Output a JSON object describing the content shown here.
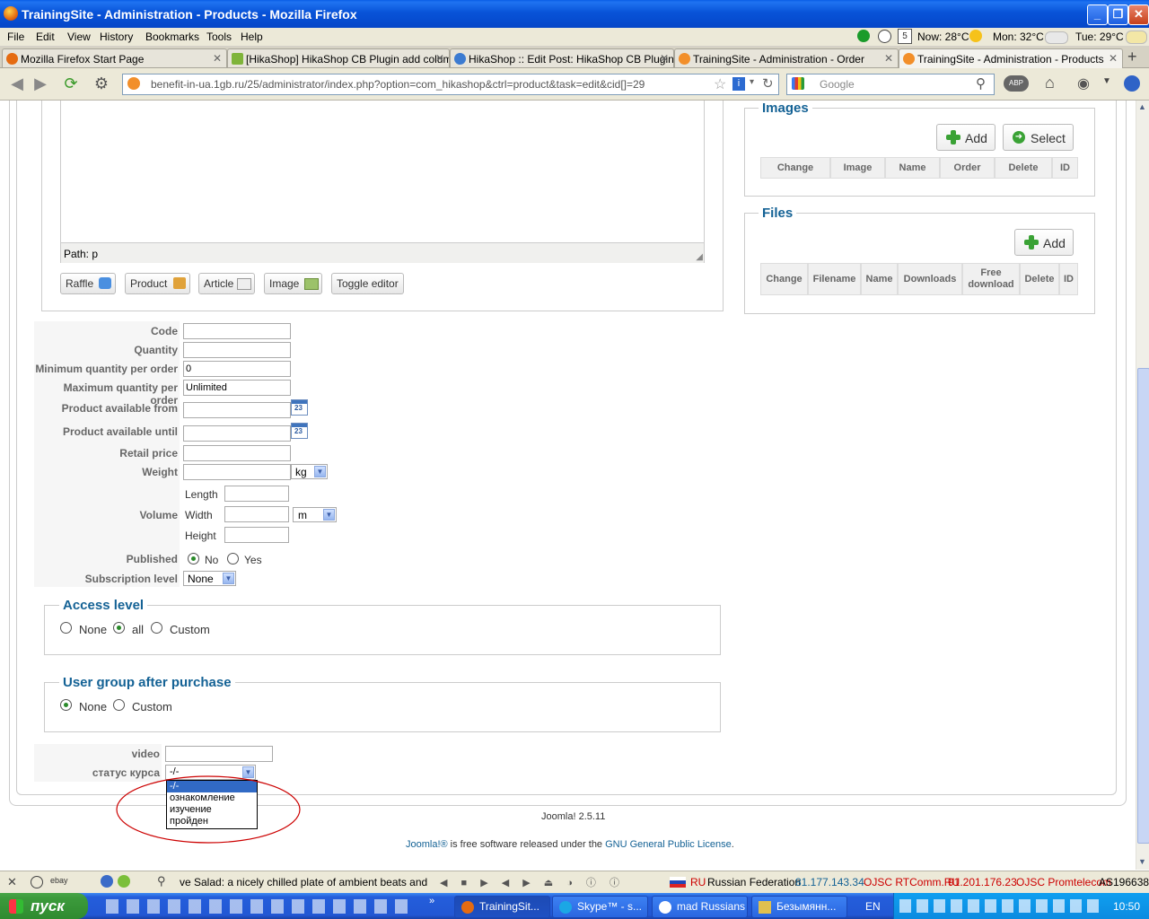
{
  "window": {
    "title": "TrainingSite - Administration - Products - Mozilla Firefox"
  },
  "menubar": {
    "items": [
      "File",
      "Edit",
      "View",
      "History",
      "Bookmarks",
      "Tools",
      "Help"
    ],
    "weather": {
      "calendar_day": "5",
      "now": "Now: 28°C",
      "mon": "Mon: 32°C",
      "tue": "Tue: 29°C"
    }
  },
  "tabs": [
    {
      "label": "Mozilla Firefox Start Page",
      "active": false
    },
    {
      "label": "[HikaShop] HikaShop CB Plugin add colum...",
      "active": false
    },
    {
      "label": "HikaShop :: Edit Post: HikaShop CB Plugin...",
      "active": false
    },
    {
      "label": "TrainingSite - Administration - Order",
      "active": false
    },
    {
      "label": "TrainingSite - Administration - Products",
      "active": true
    }
  ],
  "navbar": {
    "url": "benefit-in-ua.1gb.ru/25/administrator/index.php?option=com_hikashop&ctrl=product&task=edit&cid[]=29",
    "search_placeholder": "Google"
  },
  "editor": {
    "path": "Path: p",
    "buttons": [
      "Raffle",
      "Product",
      "Article",
      "Image",
      "Toggle editor"
    ]
  },
  "images_panel": {
    "title": "Images",
    "add": "Add",
    "select": "Select",
    "columns": [
      "Change",
      "Image",
      "Name",
      "Order",
      "Delete",
      "ID"
    ]
  },
  "files_panel": {
    "title": "Files",
    "add": "Add",
    "columns": [
      "Change",
      "Filename",
      "Name",
      "Downloads",
      "Free download",
      "Delete",
      "ID"
    ]
  },
  "form": {
    "code": {
      "label": "Code",
      "value": ""
    },
    "quantity": {
      "label": "Quantity",
      "value": ""
    },
    "min_qty": {
      "label": "Minimum quantity per order",
      "value": "0"
    },
    "max_qty": {
      "label": "Maximum quantity per order",
      "value": "Unlimited"
    },
    "available_from": {
      "label": "Product available from",
      "value": ""
    },
    "available_until": {
      "label": "Product available until",
      "value": ""
    },
    "calendar_icon_text": "23",
    "retail_price": {
      "label": "Retail price",
      "value": ""
    },
    "weight": {
      "label": "Weight",
      "value": "",
      "unit": "kg"
    },
    "volume": {
      "label": "Volume",
      "length": "Length",
      "width": "Width",
      "height": "Height",
      "unit": "m"
    },
    "published": {
      "label": "Published",
      "options": [
        "No",
        "Yes"
      ],
      "selected": "No"
    },
    "subscription": {
      "label": "Subscription level",
      "value": "None"
    }
  },
  "access_level": {
    "title": "Access level",
    "options": [
      "None",
      "all",
      "Custom"
    ],
    "selected": "all"
  },
  "user_group": {
    "title": "User group after purchase",
    "options": [
      "None",
      "Custom"
    ],
    "selected": "None"
  },
  "custom_fields": {
    "video": {
      "label": "video",
      "value": ""
    },
    "course_status": {
      "label": "статус курса",
      "value": "-/-",
      "options": [
        "-/-",
        "ознакомление",
        "изучение",
        "пройден"
      ],
      "highlighted": "-/-"
    }
  },
  "footer": {
    "version": "Joomla! 2.5.11",
    "license_prefix": "Joomla!®",
    "license_middle": " is free software released under the ",
    "license_link": "GNU General Public License",
    "license_suffix": "."
  },
  "statusbar": {
    "ebay": "ebay",
    "ticker": "ve Salad: a nicely chilled plate of ambient beats and",
    "country_code": "RU",
    "country": "Russian Federation",
    "ip1": "81.177.143.34",
    "isp1": "OJSC RTComm.RU",
    "ip2": "91.201.176.23",
    "isp2": "OJSC Promtelecom",
    "asn": "AS196638"
  },
  "taskbar": {
    "start": "пуск",
    "tasks": [
      {
        "label": "TrainingSit...",
        "active": true
      },
      {
        "label": "Skype™ - s...",
        "active": false
      },
      {
        "label": "mad Russians",
        "active": false
      },
      {
        "label": "Безымянн...",
        "active": false
      }
    ],
    "lang": "EN",
    "clock": "10:50"
  },
  "colors": {
    "link": "#146295",
    "legend": "#146295",
    "annotation": "#cc0000",
    "selected_option": "#316ac5"
  }
}
